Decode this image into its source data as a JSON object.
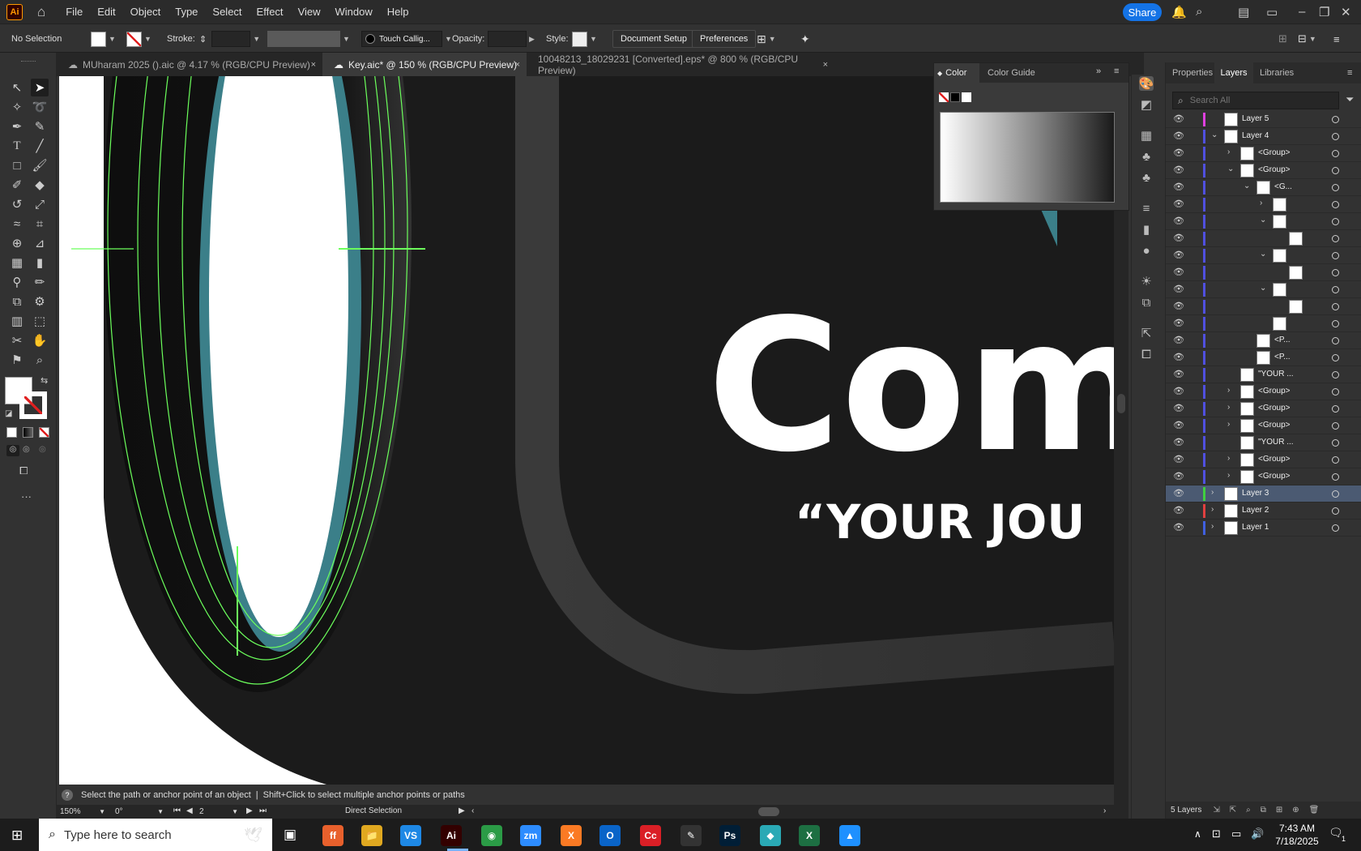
{
  "menubar": {
    "app_logo": "Ai",
    "items": [
      "File",
      "Edit",
      "Object",
      "Type",
      "Select",
      "Effect",
      "View",
      "Window",
      "Help"
    ],
    "share": "Share"
  },
  "control": {
    "selection": "No Selection",
    "stroke_label": "Stroke:",
    "brush": "Touch Callig...",
    "opacity_label": "Opacity:",
    "style_label": "Style:",
    "document_setup": "Document Setup",
    "preferences": "Preferences"
  },
  "tabs": [
    {
      "label": "MUharam 2025 ().aic @ 4.17 % (RGB/CPU Preview)",
      "close": "×"
    },
    {
      "label": "Key.aic* @ 150 % (RGB/CPU Preview)",
      "close": "×"
    },
    {
      "label": "10048213_18029231 [Converted].eps* @ 800 % (RGB/CPU Preview)",
      "close": "×"
    }
  ],
  "canvas": {
    "headline": "Com",
    "subline": "“YOUR JOU"
  },
  "color_panel": {
    "tab_color": "Color",
    "tab_guide": "Color Guide"
  },
  "right_panel": {
    "tab_properties": "Properties",
    "tab_layers": "Layers",
    "tab_libraries": "Libraries",
    "search_placeholder": "Search All",
    "layers_count": "5 Layers"
  },
  "layers": [
    {
      "name": "Layer 5",
      "indent": 0,
      "chev": "",
      "color": "#e040e0",
      "sel": false
    },
    {
      "name": "Layer 4",
      "indent": 0,
      "chev": "v",
      "color": "#5050e0",
      "sel": false
    },
    {
      "name": "<Group>",
      "indent": 1,
      "chev": ">",
      "color": "#5050e0",
      "sel": false
    },
    {
      "name": "<Group>",
      "indent": 1,
      "chev": "v",
      "color": "#5050e0",
      "sel": false
    },
    {
      "name": "<G...",
      "indent": 2,
      "chev": "v",
      "color": "#5050e0",
      "sel": false
    },
    {
      "name": "",
      "indent": 3,
      "chev": ">",
      "color": "#5050e0",
      "sel": false
    },
    {
      "name": "",
      "indent": 3,
      "chev": "v",
      "color": "#5050e0",
      "sel": false
    },
    {
      "name": "",
      "indent": 4,
      "chev": "",
      "color": "#5050e0",
      "sel": false
    },
    {
      "name": "",
      "indent": 3,
      "chev": "v",
      "color": "#5050e0",
      "sel": false
    },
    {
      "name": "",
      "indent": 4,
      "chev": "",
      "color": "#5050e0",
      "sel": false
    },
    {
      "name": "",
      "indent": 3,
      "chev": "v",
      "color": "#5050e0",
      "sel": false
    },
    {
      "name": "",
      "indent": 4,
      "chev": "",
      "color": "#5050e0",
      "sel": false
    },
    {
      "name": "",
      "indent": 3,
      "chev": "",
      "color": "#5050e0",
      "sel": false
    },
    {
      "name": "<P...",
      "indent": 2,
      "chev": "",
      "color": "#5050e0",
      "sel": false
    },
    {
      "name": "<P...",
      "indent": 2,
      "chev": "",
      "color": "#5050e0",
      "sel": false
    },
    {
      "name": "\"YOUR ...",
      "indent": 1,
      "chev": "",
      "color": "#5050e0",
      "sel": false
    },
    {
      "name": "<Group>",
      "indent": 1,
      "chev": ">",
      "color": "#5050e0",
      "sel": false
    },
    {
      "name": "<Group>",
      "indent": 1,
      "chev": ">",
      "color": "#5050e0",
      "sel": false
    },
    {
      "name": "<Group>",
      "indent": 1,
      "chev": ">",
      "color": "#5050e0",
      "sel": false
    },
    {
      "name": "\"YOUR ...",
      "indent": 1,
      "chev": "",
      "color": "#5050e0",
      "sel": false
    },
    {
      "name": "<Group>",
      "indent": 1,
      "chev": ">",
      "color": "#5050e0",
      "sel": false
    },
    {
      "name": "<Group>",
      "indent": 1,
      "chev": ">",
      "color": "#5050e0",
      "sel": false
    },
    {
      "name": "Layer 3",
      "indent": 0,
      "chev": ">",
      "color": "#40d040",
      "sel": true
    },
    {
      "name": "Layer 2",
      "indent": 0,
      "chev": ">",
      "color": "#e04040",
      "sel": false
    },
    {
      "name": "Layer 1",
      "indent": 0,
      "chev": ">",
      "color": "#4060e0",
      "sel": false
    }
  ],
  "status": {
    "message": "Select the path or anchor point of an object",
    "separator": "|",
    "hint": "Shift+Click to select multiple anchor points or paths",
    "zoom": "150%",
    "rotation": "0°",
    "artboard": "2",
    "tool": "Direct Selection"
  },
  "taskbar": {
    "search_placeholder": "Type here to search",
    "time": "7:43 AM",
    "date": "7/18/2025",
    "notif": "1",
    "apps": [
      {
        "label": "ff",
        "color": "#e8602c"
      },
      {
        "label": "📁",
        "color": "#e0a820"
      },
      {
        "label": "VS",
        "color": "#1e88e5"
      },
      {
        "label": "Ai",
        "color": "#330000"
      },
      {
        "label": "◉",
        "color": "#2b9b46"
      },
      {
        "label": "zm",
        "color": "#2d8cff"
      },
      {
        "label": "X",
        "color": "#fb7a24"
      },
      {
        "label": "O",
        "color": "#0a64c8"
      },
      {
        "label": "Cc",
        "color": "#da1f26"
      },
      {
        "label": "✎",
        "color": "#333333"
      },
      {
        "label": "Ps",
        "color": "#001e36"
      },
      {
        "label": "◆",
        "color": "#2aa9b5"
      },
      {
        "label": "X",
        "color": "#1d6f42"
      },
      {
        "label": "▲",
        "color": "#1e90ff"
      }
    ]
  }
}
